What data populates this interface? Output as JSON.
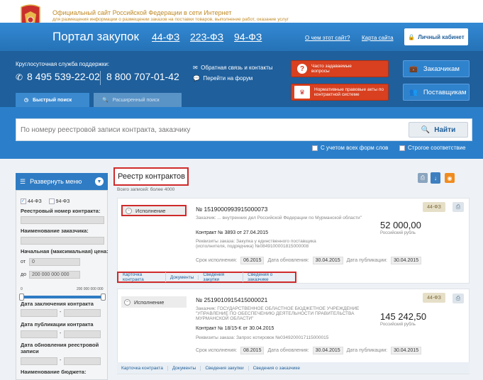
{
  "header": {
    "site_title": "Официальный сайт Российской Федерации в сети Интернет",
    "site_subtitle": "для размещения информации о размещении заказов на поставки товаров, выполнение работ, оказание услуг",
    "portal_title": "Портал закупок",
    "laws": [
      "44-ФЗ",
      "223-ФЗ",
      "94-ФЗ"
    ],
    "about_link": "О чем этот сайт?",
    "sitemap_link": "Карта сайта",
    "cabinet_button": "Личный кабинет"
  },
  "support": {
    "label": "Круглосуточная служба поддержки:",
    "phone1": "8 495 539-22-02",
    "phone2": "8 800 707-01-42",
    "feedback_link": "Обратная связь и контакты",
    "forum_link": "Перейти на форум",
    "faq_button": "Часто задаваемые вопросы",
    "legal_button": "Нормативные правовые акты по контрактной системе",
    "customers_button": "Заказчикам",
    "suppliers_button": "Поставщикам"
  },
  "search": {
    "tab_quick": "Быстрый поиск",
    "tab_advanced": "Расширенный поиск",
    "placeholder": "По номеру реестровой записи контракта, заказчику",
    "find_button": "Найти",
    "opt_all_forms": "С учетом всех форм слов",
    "opt_strict": "Строгое соответствие"
  },
  "sidebar": {
    "menu_button": "Развернуть меню",
    "law_44": "44-ФЗ",
    "law_94": "94-ФЗ",
    "reg_number_label": "Реестровый номер контракта:",
    "customer_label": "Наименование заказчика:",
    "price_label": "Начальная (максимальная) цена:",
    "from_label": "от",
    "from_value": "0",
    "to_label": "до",
    "to_value": "200 000 000 000",
    "slider_min": "0",
    "slider_max": "200 000 000 000",
    "conclusion_date_label": "Дата заключения контракта",
    "publication_date_label": "Дата публикации контракта",
    "update_date_label": "Дата обновления реестровой записи",
    "budget_label": "Наименование бюджета:"
  },
  "registry": {
    "title": "Реестр контрактов",
    "total": "Всего записей: более 4000",
    "cards": [
      {
        "status": "Исполнение",
        "number": "№ 1519000993915000073",
        "customer": "Заказчик: ... внутренних дел Российской Федерации по Мурманской области\"",
        "contract": "Контракт № 3893 от 27.04.2015",
        "requisites": "Реквизиты заказа: Закупка у единственного поставщика (исполнителя, подрядчика) №0849100001815000008",
        "amount": "52 000,00",
        "currency": "Российский рубль",
        "law": "44-ФЗ",
        "term_label": "Срок исполнения:",
        "term_value": "06.2015",
        "updated_label": "Дата обновления:",
        "updated_value": "30.04.2015",
        "published_label": "Дата публикации:",
        "published_value": "30.04.2015",
        "links": [
          "Карточка контракта",
          "Документы",
          "Сведения закупки",
          "Сведения о заказчике"
        ]
      },
      {
        "status": "Исполнение",
        "number": "№ 2519010915415000021",
        "customer": "Заказчик: ГОСУДАРСТВЕННОЕ ОБЛАСТНОЕ БЮДЖЕТНОЕ УЧРЕЖДЕНИЕ \"УПРАВЛЕНИЕ ПО ОБЕСПЕЧЕНИЮ ДЕЯТЕЛЬНОСТИ ПРАВИТЕЛЬСТВА МУРМАНСКОЙ ОБЛАСТИ\"",
        "contract": "Контракт № 18/15-К от 30.04.2015",
        "requisites": "Реквизиты заказа: Запрос котировок №0349200017115000015",
        "amount": "145 242,50",
        "currency": "Российский рубль",
        "law": "44-ФЗ",
        "term_label": "Срок исполнения:",
        "term_value": "08.2015",
        "updated_label": "Дата обновления:",
        "updated_value": "30.04.2015",
        "published_label": "Дата публикации:",
        "published_value": "30.04.2015",
        "links": [
          "Карточка контракта",
          "Документы",
          "Сведения закупки",
          "Сведения о заказчике"
        ]
      }
    ]
  }
}
